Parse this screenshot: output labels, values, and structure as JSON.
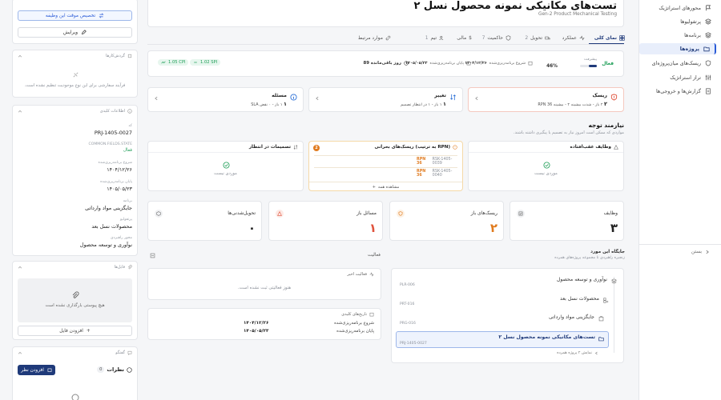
{
  "sidebar": {
    "items": [
      {
        "label": "محورهای استراتژیک",
        "icon": "flag-icon"
      },
      {
        "label": "پرتفولیوها",
        "icon": "layers-icon"
      },
      {
        "label": "برنامه‌ها",
        "icon": "layers-icon"
      },
      {
        "label": "پروژه‌ها",
        "icon": "folder-icon",
        "active": true
      },
      {
        "label": "ریسک‌های میان‌پروژه‌ای",
        "icon": "shield-icon"
      },
      {
        "label": "تراز استراتژیک",
        "icon": "sliders-icon"
      },
      {
        "label": "گزارش‌ها و خروجی‌ها",
        "icon": "report-icon"
      }
    ],
    "collapse_label": "بستن"
  },
  "left": {
    "assign_button": "تخصیص موقت این وظیفه",
    "edit_button": "ویرایش",
    "workflow": {
      "title": "گردش‌کارها",
      "empty": "فرآیند سفارشی برای این نوع موجودیت تنظیم نشده است."
    },
    "info": {
      "title": "اطلاعات کلیدی",
      "code_label": "کد",
      "code": "PRJ-1405-0027",
      "state_label": "COMMON.FIELDS.STATE",
      "state": "فعال",
      "start_label": "شروع برنامه‌ریزی‌شده",
      "start": "۱۴۰۴/۱۲/۲۶",
      "end_label": "پایان برنامه‌ریزی‌شده",
      "end": "۱۴۰۵/۰۵/۲۳",
      "program_label": "برنامه",
      "program": "جایگزینی مواد وارداتی",
      "portfolio_label": "پرتفولیو",
      "portfolio": "محصولات نسل بعد",
      "axis_label": "محور راهبردی",
      "axis": "نوآوری و توسعه محصول"
    },
    "files": {
      "title": "فایل‌ها",
      "empty": "هیچ پیوستی بارگذاری نشده است",
      "add_button": "افزودن فایل"
    },
    "comments": {
      "title": "گفتگو",
      "heading": "نظرات",
      "count": "0",
      "add_button": "افزودن نظر"
    }
  },
  "header": {
    "title": "تست‌های مکانیکی نمونه محصول نسل ۲",
    "subtitle": "Gen-2 Product Mechanical Testing"
  },
  "tabs": [
    {
      "label": "نمای کلی",
      "icon": "grid-icon",
      "active": true
    },
    {
      "label": "عملکرد",
      "icon": "pulse-icon"
    },
    {
      "label": "تحویل",
      "icon": "truck-icon",
      "count": "2"
    },
    {
      "label": "حاکمیت",
      "icon": "shield-icon",
      "count": "7"
    },
    {
      "label": "مالی",
      "icon": "dollar-icon"
    },
    {
      "label": "تیم",
      "icon": "team-icon",
      "count": "1"
    },
    {
      "label": "موارد مرتبط",
      "icon": "link-icon"
    }
  ],
  "status_bar": {
    "status": "فعال",
    "progress_label": "پیشرفت",
    "progress_value": "46%",
    "progress_fraction": 0.46,
    "start_label": "شروع برنامه‌ریزی‌شده",
    "start": "۱۴۰۴/۱۲/۲۶",
    "end_label": "پایان برنامه‌ریزی‌شده",
    "end": "۱۴۰۵/۰۵/۲۳",
    "remaining": "89 روز باقی‌مانده",
    "spi": "1.02 SPI",
    "cpi": "1.05 CPI"
  },
  "kpi_cards": [
    {
      "title": "ریسک",
      "value": "۲",
      "detail": "۲ باز - شدت بیشینه ۴ - بیشینه RPN 36",
      "icon": "alert-shield-icon",
      "color": "#e0533d"
    },
    {
      "title": "تغییر",
      "value": "۱",
      "detail": "۱ باز - ۱ در انتظار تصمیم",
      "icon": "swap-icon",
      "color": "#2a6fd6"
    },
    {
      "title": "مسئله",
      "value": "۱",
      "detail": "۱ باز - ۰ نقض SLA",
      "icon": "info-icon",
      "color": "#2a6fd6"
    }
  ],
  "attention": {
    "title": "نیازمند توجه",
    "subtitle": "مواردی که ممکن است امروز نیاز به تصمیم یا پیگیری داشته باشند.",
    "overdue": {
      "title": "وظایف عقب‌افتاده",
      "empty": "موردی نیست"
    },
    "risks": {
      "title": "ریسک‌های بحرانی (به ترتیب RPN)",
      "count": "2",
      "rows": [
        {
          "code": "RSK-1405-0039",
          "rpn": "RPN 36"
        },
        {
          "code": "RSK-1405-0040",
          "rpn": "RPN 36"
        }
      ],
      "view_all": "مشاهده همه"
    },
    "decisions": {
      "title": "تصمیمات در انتظار",
      "empty": "موردی نیست"
    }
  },
  "counts": [
    {
      "title": "وظایف",
      "value": "۳",
      "icon": "check-square-icon",
      "color": "#222"
    },
    {
      "title": "ریسک‌های باز",
      "value": "۲",
      "icon": "shield-icon",
      "color": "#e07b1f"
    },
    {
      "title": "مسائل باز",
      "value": "۱",
      "icon": "warning-icon",
      "color": "#e0533d"
    },
    {
      "title": "تحویل‌شدنی‌ها",
      "value": "۰",
      "icon": "package-icon",
      "color": "#222"
    }
  ],
  "hierarchy": {
    "title": "جایگاه این مورد",
    "subtitle": "زنجیره راهبردی تا مجموعه پروژه‌های همرده",
    "nodes": [
      {
        "name": "نوآوری و توسعه محصول",
        "code": "PLR-006",
        "icon": "layers-icon"
      },
      {
        "name": "محصولات نسل بعد",
        "code": "PRT-016",
        "icon": "grid-plus-icon"
      },
      {
        "name": "جایگزینی مواد وارداتی",
        "code": "PRG-016",
        "icon": "stack-icon"
      },
      {
        "name": "تست‌های مکانیکی نمونه محصول نسل ۲",
        "code": "PRJ-1405-0027",
        "icon": "folder-icon",
        "current": true
      }
    ],
    "siblings": "نمایش ۲ پروژه همرده"
  },
  "activity": {
    "title": "فعالیت",
    "recent_title": "فعالیت اخیر",
    "recent_empty": "هنوز فعالیتی ثبت نشده است.",
    "dates_title": "تاریخ‌های کلیدی",
    "start_label": "شروع برنامه‌ریزی‌شده",
    "start": "۱۴۰۴/۱۲/۲۶",
    "end_label": "پایان برنامه‌ریزی‌شده",
    "end": "۱۴۰۵/۰۵/۲۳"
  },
  "colors": {
    "accent": "#2a5bd7",
    "green": "#1e9e57",
    "orange": "#e07b1f",
    "red": "#e0533d"
  }
}
